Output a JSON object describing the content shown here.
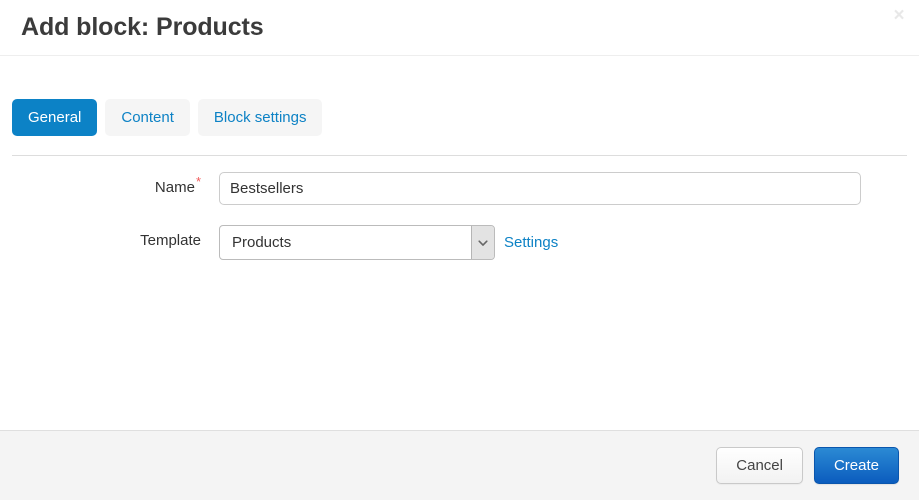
{
  "dialog": {
    "title": "Add block: Products",
    "close_icon": "close-icon",
    "close_label": "×"
  },
  "tabs": [
    {
      "label": "General",
      "name": "tab-general",
      "active": true
    },
    {
      "label": "Content",
      "name": "tab-content",
      "active": false
    },
    {
      "label": "Block settings",
      "name": "tab-block-settings",
      "active": false
    }
  ],
  "form": {
    "name_field": {
      "label": "Name",
      "required_mark": "*",
      "value": "Bestsellers",
      "placeholder": ""
    },
    "template_field": {
      "label": "Template",
      "selected": "Products",
      "options": [
        "Products"
      ],
      "arrow_icon": "chevron-down-icon",
      "settings_link": "Settings"
    }
  },
  "footer": {
    "cancel_label": "Cancel",
    "create_label": "Create"
  },
  "colors": {
    "accent_blue": "#0d82c5",
    "tab_active_bg": "#0c82c6",
    "create_button_top": "#2b8ad4",
    "create_button_bottom": "#0b5cbe",
    "required_red": "#f05b5b",
    "footer_bg": "#f4f4f4"
  }
}
